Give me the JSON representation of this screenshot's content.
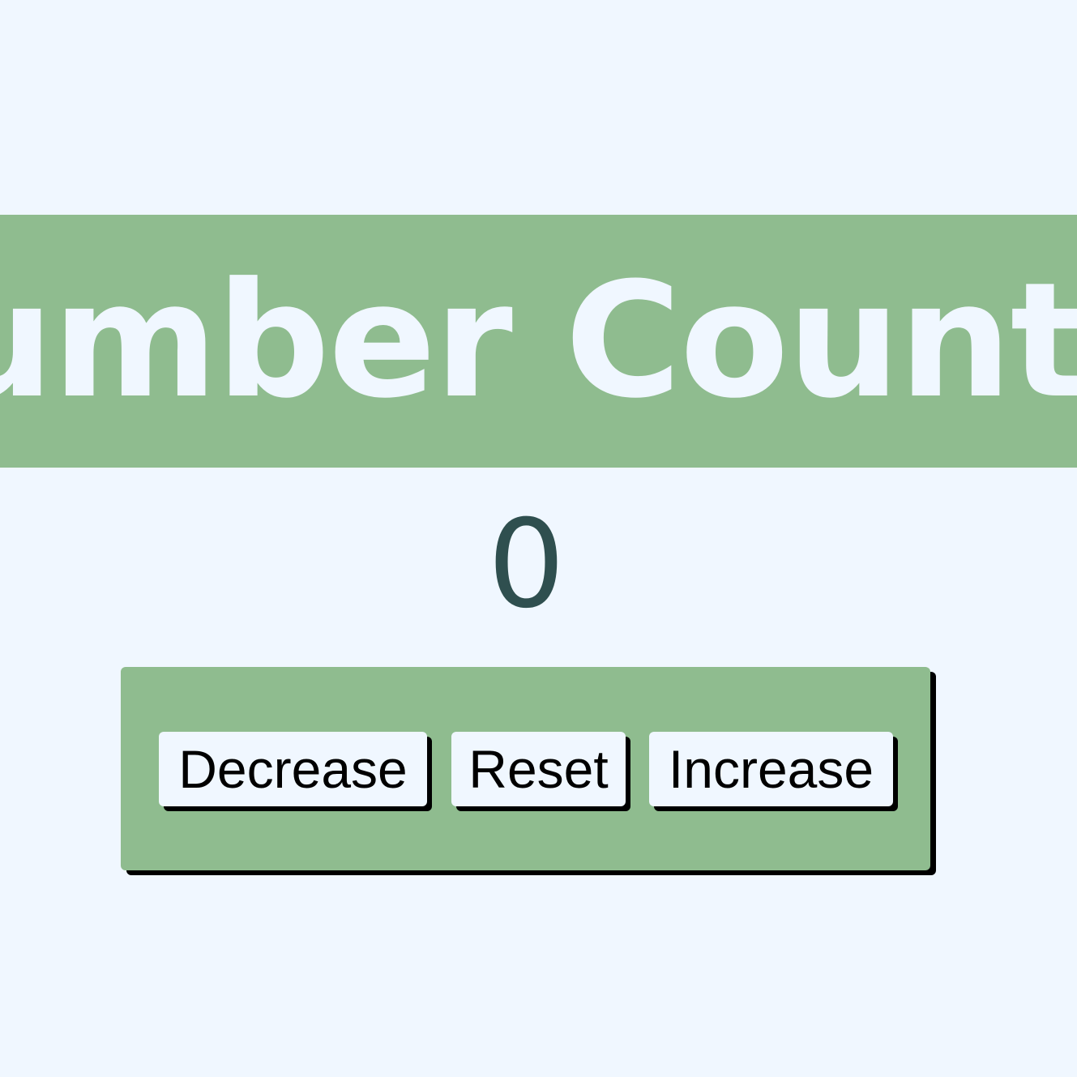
{
  "header": {
    "title": "Number Counter"
  },
  "counter": {
    "value": "0"
  },
  "controls": {
    "decrease_label": "Decrease",
    "reset_label": "Reset",
    "increase_label": "Increase"
  },
  "colors": {
    "background": "#f0f7ff",
    "accent": "#8fbc8f",
    "counter_text": "#2f4f4f",
    "shadow": "#000000"
  }
}
